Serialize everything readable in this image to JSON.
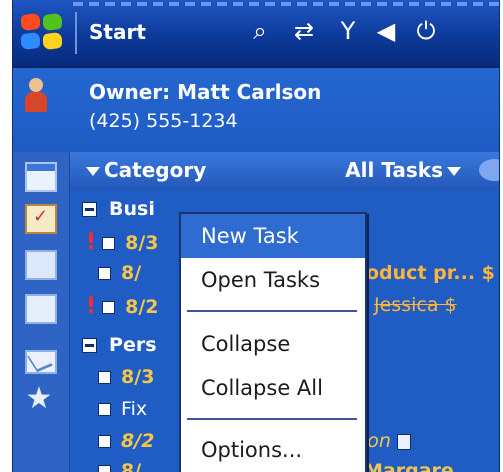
{
  "titlebar": {
    "title": "Start",
    "icons": [
      "windows-logo",
      "search-icon",
      "sync-icon",
      "signal-icon",
      "speaker-icon",
      "power-icon"
    ]
  },
  "owner": {
    "name": "Owner: Matt Carlson",
    "phone": "(425) 555-1234"
  },
  "category_bar": {
    "left": "Category",
    "right": "All Tasks"
  },
  "list": {
    "group1": "Busi",
    "g1_rows": [
      {
        "prefix": "8/3",
        "title": ""
      },
      {
        "prefix": "8/",
        "title": "oduct pr... $"
      },
      {
        "prefix": "8/2",
        "title": "Jessica $"
      }
    ],
    "group2": "Pers",
    "g2_rows": [
      {
        "prefix": "8/3",
        "title": ""
      },
      {
        "prefix": "Fix",
        "title": ""
      },
      {
        "prefix": "8/2",
        "title": "ion"
      },
      {
        "prefix": "8/",
        "title": "Margare..."
      }
    ]
  },
  "menu": {
    "new_task": "New Task",
    "open_tasks": "Open Tasks",
    "collapse": "Collapse",
    "collapse_all": "Collapse All",
    "options": "Options..."
  },
  "colors": {
    "titlebar": "#0d3a9a",
    "background": "#1f5cc3",
    "menu_highlight": "#2f6cd2",
    "due_text": "#f3c64b"
  }
}
